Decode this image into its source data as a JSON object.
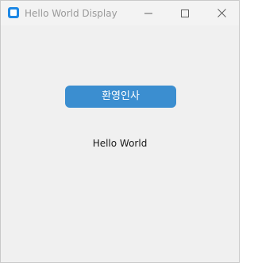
{
  "window": {
    "title": "Hello World Display",
    "app_icon": "app-icon",
    "controls": {
      "minimize_icon": "minimize-icon",
      "maximize_icon": "maximize-icon",
      "close_icon": "close-icon"
    }
  },
  "main": {
    "greet_button_label": "환영인사",
    "output_text": "Hello World"
  },
  "colors": {
    "button_bg": "#3b8ed0",
    "button_text": "#ffffff",
    "window_bg": "#f0f0f0",
    "title_text": "#9a9a9a",
    "app_icon": "#1e88e5"
  }
}
